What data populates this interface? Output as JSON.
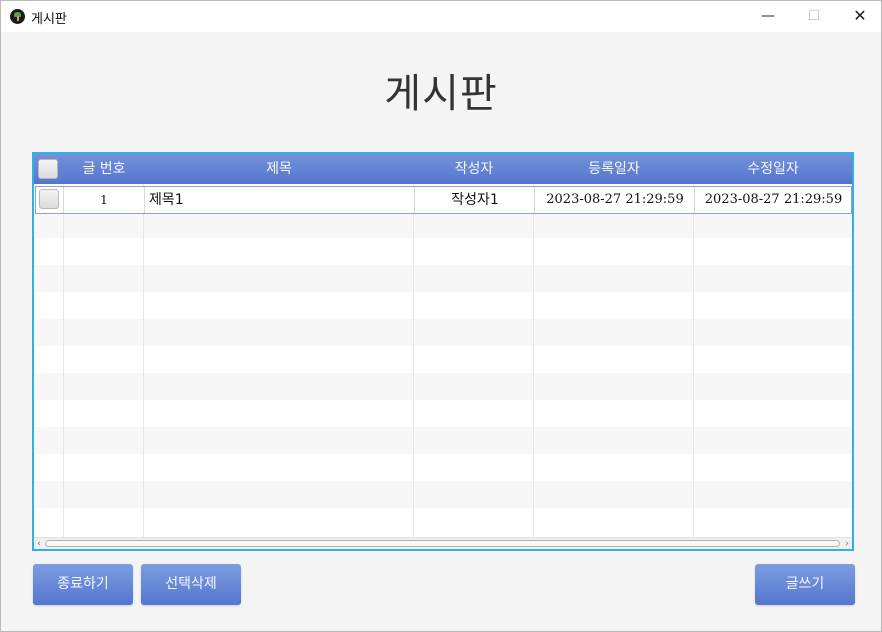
{
  "window": {
    "title": "게시판",
    "controls": {
      "minimize": "—",
      "maximize": "☐",
      "close": "✕"
    }
  },
  "page": {
    "heading": "게시판"
  },
  "table": {
    "columns": [
      "글 번호",
      "제목",
      "작성자",
      "등록일자",
      "수정일자"
    ],
    "rows": [
      {
        "checked": false,
        "no": "1",
        "title": "제목1",
        "author": "작성자1",
        "created": "2023-08-27 21:29:59",
        "modified": "2023-08-27 21:29:59"
      }
    ],
    "empty_row_count": 12
  },
  "buttons": {
    "exit": "종료하기",
    "delete_selected": "선택삭제",
    "write": "글쓰기"
  },
  "colors": {
    "accent": "#5a7bd1",
    "grid_border": "#2fb0e6",
    "window_bg": "#f4f4f4"
  }
}
